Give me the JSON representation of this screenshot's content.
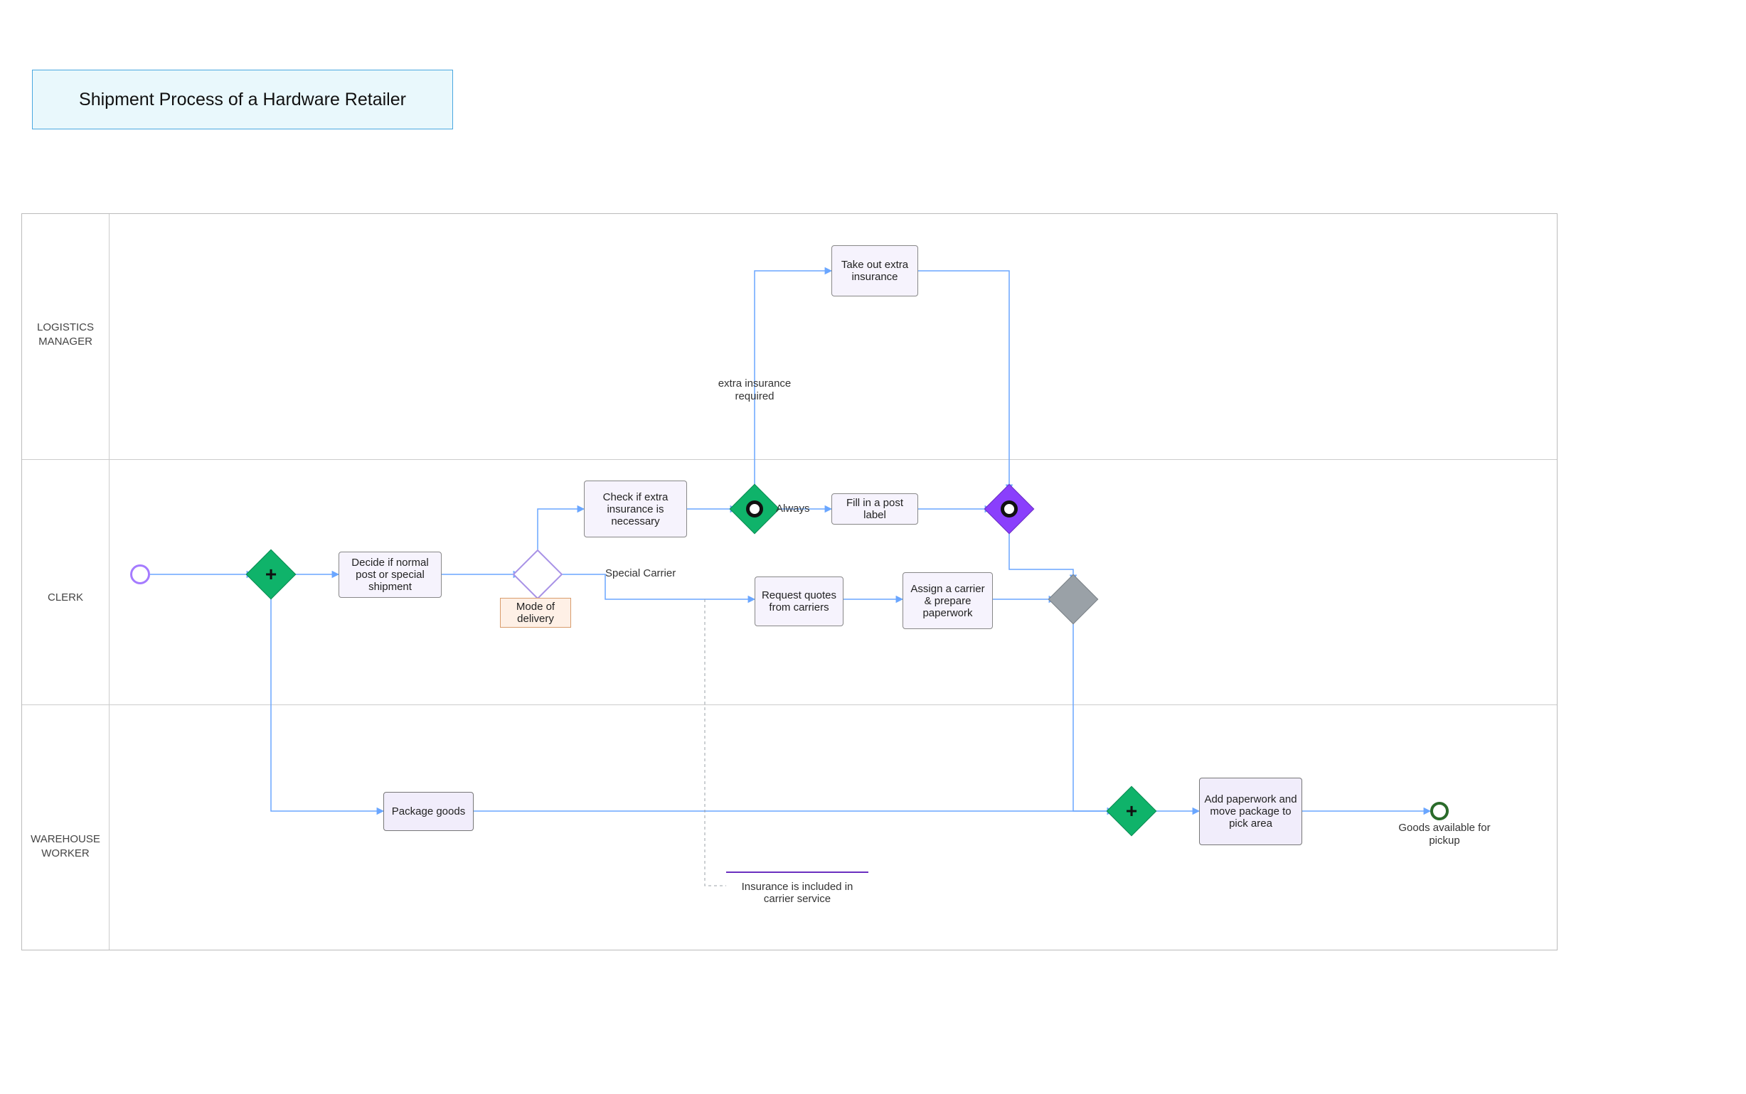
{
  "colors": {
    "title_border": "#4aa8e0",
    "title_bg": "#e9f8fc",
    "task_bg": "#f6f3fd",
    "annotation_border": "#d89c6c",
    "annotation_bg": "#fef0e6",
    "note_border": "#6a2fc0",
    "gateway_green": "#0fb36a",
    "gateway_purple": "#8a3ffc",
    "gateway_gray": "#9aa1a7"
  },
  "title": "Shipment Process of a Hardware Retailer",
  "lanes": {
    "logistics": "LOGISTICS MANAGER",
    "clerk": "CLERK",
    "warehouse": "WAREHOUSE WORKER"
  },
  "tasks": {
    "insurance": "Take out extra insurance",
    "decide": "Decide if normal post or special shipment",
    "check": "Check if extra insurance is necessary",
    "fill_label": "Fill in a post label",
    "request_quotes": "Request quotes from carriers",
    "assign_carrier": "Assign a carrier & prepare paperwork",
    "package": "Package goods",
    "add_paperwork": "Add paperwork and move package to pick area"
  },
  "annotations": {
    "mode": "Mode of delivery",
    "note": "Insurance is included in carrier service"
  },
  "edge_labels": {
    "extra_required": "extra insurance required",
    "always": "Always",
    "special": "Special Carrier",
    "end": "Goods available for pickup"
  }
}
